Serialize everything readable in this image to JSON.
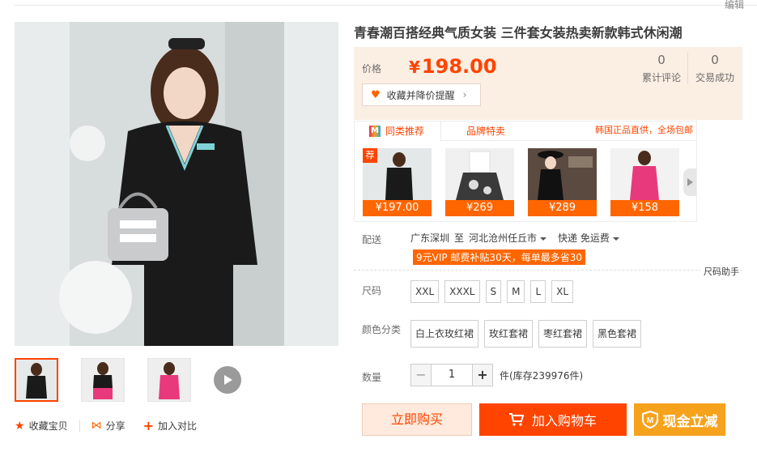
{
  "header": {
    "edit_label": "编辑"
  },
  "product": {
    "title": "青春潮百搭经典气质女装 三件套女装热卖新款韩式休闲潮",
    "price_label": "价格",
    "currency": "¥",
    "price": "198.00",
    "favorite_label": "收藏并降价提醒",
    "stats": [
      {
        "value": "0",
        "label": "累计评论"
      },
      {
        "value": "0",
        "label": "交易成功"
      }
    ]
  },
  "recommend": {
    "tab_similar": "同类推荐",
    "tab_brand": "品牌特卖",
    "promo": "韩国正品直供，全场包邮",
    "badge": "荐",
    "items": [
      {
        "price": "¥197.00"
      },
      {
        "price": "¥269"
      },
      {
        "price": "¥289"
      },
      {
        "price": "¥158"
      }
    ]
  },
  "shipping": {
    "label": "配送",
    "from": "广东深圳",
    "to_word": "至",
    "to": "河北沧州任丘市",
    "method": "快递 免运费",
    "vip_promo": "9元VIP 邮费补贴30天，每单最多省30"
  },
  "size": {
    "label": "尺码",
    "helper": "尺码助手",
    "options": [
      "XXL",
      "XXXL",
      "S",
      "M",
      "L",
      "XL"
    ]
  },
  "color": {
    "label": "颜色分类",
    "options": [
      "白上衣玫红裙",
      "玫红套裙",
      "枣红套裙",
      "黑色套裙"
    ]
  },
  "quantity": {
    "label": "数量",
    "minus": "−",
    "value": "1",
    "plus": "+",
    "stock": "件(库存239976件)"
  },
  "buttons": {
    "buy_now": "立即购买",
    "add_cart": "加入购物车",
    "cash": "现金立减"
  },
  "gallery_actions": {
    "favorite": "收藏宝贝",
    "share": "分享",
    "compare": "加入对比"
  },
  "colors": {
    "accent": "#ff4400",
    "orange": "#ff6600",
    "gold": "#f7a21d",
    "price_bg": "#fbeee3"
  }
}
